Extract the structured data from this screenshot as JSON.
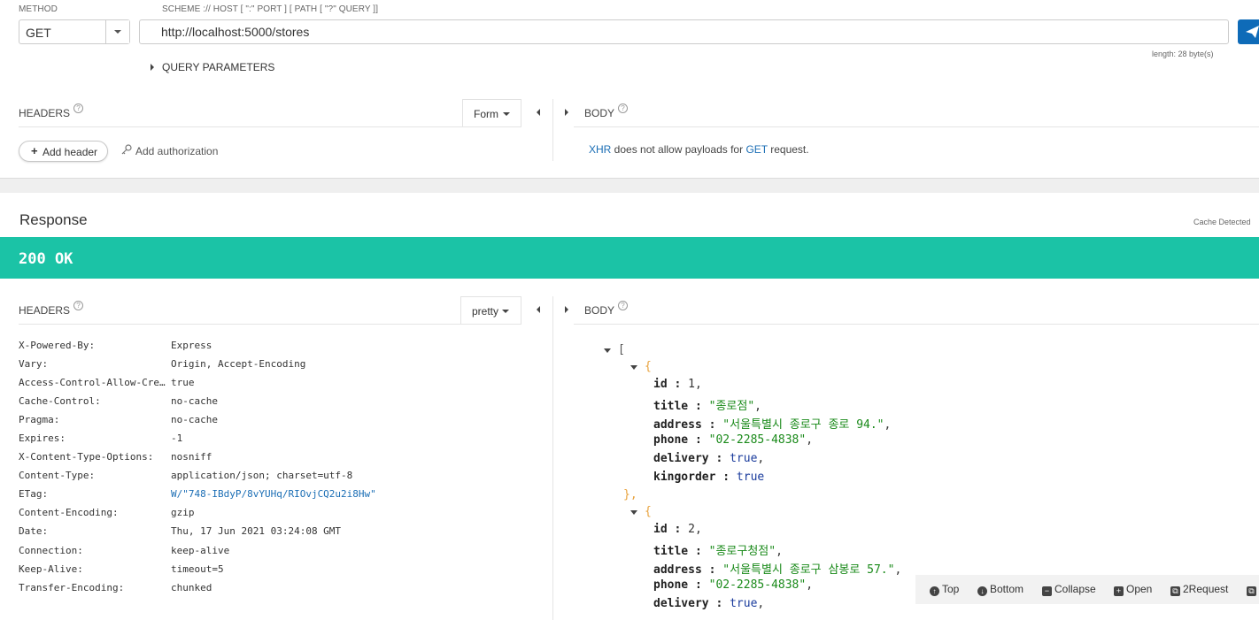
{
  "request": {
    "method_label": "METHOD",
    "method_value": "GET",
    "url_label": "SCHEME :// HOST [ \":\" PORT ] [ PATH [ \"?\" QUERY ]]",
    "url_value": "http://localhost:5000/stores",
    "length_info": "length: 28 byte(s)",
    "query_params_label": "QUERY PARAMETERS",
    "headers_label": "HEADERS",
    "help_glyph": "?",
    "form_label": "Form",
    "body_label": "BODY",
    "add_header_plus": "+",
    "add_header_label": "Add header",
    "add_auth_label": "Add authorization",
    "xhr_note": {
      "xhr": "XHR",
      "mid": " does not allow payloads for ",
      "get": "GET",
      "end": " request."
    }
  },
  "response": {
    "title": "Response",
    "cache_info": "Cache Detected",
    "status": "200 OK",
    "status_color": "#1bc3a6",
    "headers_label": "HEADERS",
    "pretty_label": "pretty",
    "body_label": "BODY",
    "headers": [
      {
        "key": "X-Powered-By:",
        "value": "Express"
      },
      {
        "key": "Vary:",
        "value": "Origin, Accept-Encoding"
      },
      {
        "key": "Access-Control-Allow-Cre…",
        "value": "true"
      },
      {
        "key": "Cache-Control:",
        "value": "no-cache"
      },
      {
        "key": "Pragma:",
        "value": "no-cache"
      },
      {
        "key": "Expires:",
        "value": "-1"
      },
      {
        "key": "X-Content-Type-Options:",
        "value": "nosniff"
      },
      {
        "key": "Content-Type:",
        "value": "application/json; charset=utf-8"
      },
      {
        "key": "ETag:",
        "value": "W/\"748-IBdyP/8vYUHq/RIOvjCQ2u2i8Hw\""
      },
      {
        "key": "Content-Encoding:",
        "value": "gzip"
      },
      {
        "key": "Date:",
        "value": "Thu, 17 Jun 2021 03:24:08 GMT"
      },
      {
        "key": "Connection:",
        "value": "keep-alive"
      },
      {
        "key": "Keep-Alive:",
        "value": "timeout=5"
      },
      {
        "key": "Transfer-Encoding:",
        "value": "chunked"
      }
    ],
    "body": {
      "open_bracket": "[",
      "open_brace": "{",
      "close_brace": "},",
      "items": [
        {
          "id": "1",
          "title": "\"종로점\"",
          "address": "\"서울특별시 종로구 종로 94.\"",
          "phone": "\"02-2285-4838\"",
          "delivery": "true",
          "kingorder": "true"
        },
        {
          "id": "2",
          "title": "\"종로구청점\"",
          "address": "\"서울특별시 종로구 삼봉로 57.\"",
          "phone": "\"02-2285-4838\"",
          "delivery": "true",
          "kingorder": "…"
        }
      ]
    },
    "toolbar": {
      "top": "Top",
      "bottom": "Bottom",
      "collapse": "Collapse",
      "open": "Open",
      "request": "2Request"
    }
  }
}
